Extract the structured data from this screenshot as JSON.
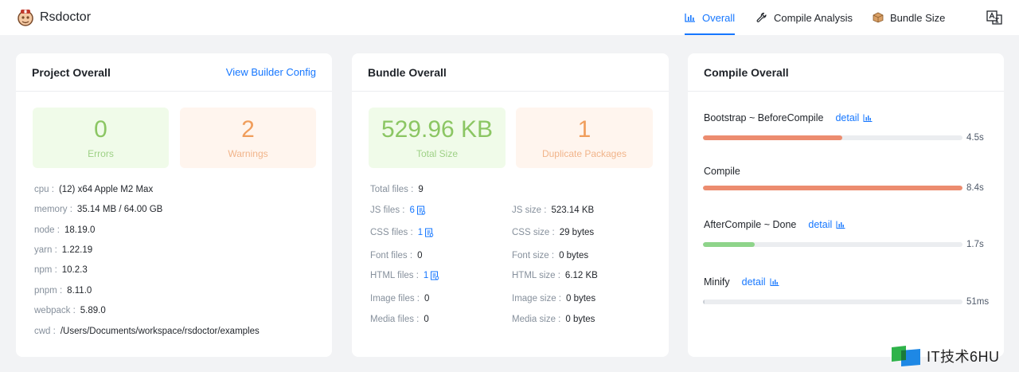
{
  "app": {
    "name": "Rsdoctor"
  },
  "nav": {
    "overall": "Overall",
    "compile_analysis": "Compile Analysis",
    "bundle_size": "Bundle Size"
  },
  "project": {
    "title": "Project Overall",
    "link": "View Builder Config",
    "errors": {
      "value": "0",
      "label": "Errors"
    },
    "warnings": {
      "value": "2",
      "label": "Warnings"
    },
    "info": [
      {
        "key": "cpu :",
        "value": "(12) x64 Apple M2 Max"
      },
      {
        "key": "memory :",
        "value": "35.14 MB / 64.00 GB"
      },
      {
        "key": "node :",
        "value": "18.19.0"
      },
      {
        "key": "yarn :",
        "value": "1.22.19"
      },
      {
        "key": "npm :",
        "value": "10.2.3"
      },
      {
        "key": "pnpm :",
        "value": "8.11.0"
      },
      {
        "key": "webpack :",
        "value": "5.89.0"
      },
      {
        "key": "cwd :",
        "value": "/Users/Documents/workspace/rsdoctor/examples"
      }
    ]
  },
  "bundle": {
    "title": "Bundle Overall",
    "total_size": {
      "value": "529.96 KB",
      "label": "Total Size"
    },
    "duplicate": {
      "value": "1",
      "label": "Duplicate Packages"
    },
    "files": [
      {
        "key": "Total files :",
        "value": "9"
      },
      {
        "key": "JS files :",
        "value": "6"
      },
      {
        "key": "CSS files :",
        "value": "1"
      },
      {
        "key": "Font files :",
        "value": "0"
      },
      {
        "key": "HTML files :",
        "value": "1"
      },
      {
        "key": "Image files :",
        "value": "0"
      },
      {
        "key": "Media files :",
        "value": "0"
      }
    ],
    "sizes": [
      {
        "key": "JS size :",
        "value": "523.14 KB"
      },
      {
        "key": "CSS size :",
        "value": "29 bytes"
      },
      {
        "key": "Font size :",
        "value": "0 bytes"
      },
      {
        "key": "HTML size :",
        "value": "6.12 KB"
      },
      {
        "key": "Image size :",
        "value": "0 bytes"
      },
      {
        "key": "Media size :",
        "value": "0 bytes"
      }
    ]
  },
  "compile": {
    "title": "Compile Overall",
    "detail_label": "detail",
    "steps": [
      {
        "name": "Bootstrap ~ BeforeCompile",
        "time": "4.5s",
        "fraction": 0.536,
        "color": "#ec8c6f",
        "has_detail": true
      },
      {
        "name": "Compile",
        "time": "8.4s",
        "fraction": 1.0,
        "color": "#ec8c6f",
        "has_detail": false
      },
      {
        "name": "AfterCompile ~ Done",
        "time": "1.7s",
        "fraction": 0.2,
        "color": "#8ed48a",
        "has_detail": true
      },
      {
        "name": "Minify",
        "time": "51ms",
        "fraction": 0.006,
        "color": "#c9cdd4",
        "has_detail": true
      }
    ]
  },
  "watermark": {
    "text": "IT技术6HU"
  },
  "colors": {
    "accent": "#1677ff",
    "success": "#8bc663",
    "warning": "#f09d5b",
    "bar_hot": "#ec8c6f",
    "bar_ok": "#8ed48a"
  }
}
